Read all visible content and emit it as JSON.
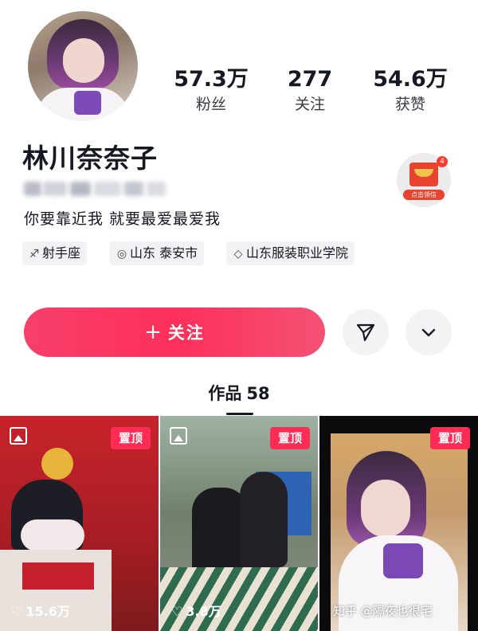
{
  "profile": {
    "username": "林川奈奈子",
    "signature": "你要靠近我 就要最爱最爱我"
  },
  "stats": [
    {
      "value": "57.3万",
      "label": "粉丝"
    },
    {
      "value": "277",
      "label": "关注"
    },
    {
      "value": "54.6万",
      "label": "获赞"
    }
  ],
  "tags": [
    {
      "icon": "zodiac-icon",
      "glyph": "♐",
      "label": "射手座"
    },
    {
      "icon": "location-icon",
      "glyph": "◎",
      "label": "山东 泰安市"
    },
    {
      "icon": "school-icon",
      "glyph": "◇",
      "label": "山东服装职业学院"
    }
  ],
  "gift_badge": {
    "count": "4",
    "label": "点击领信"
  },
  "actions": {
    "follow_label": "关注",
    "follow_glyph": "+",
    "share_icon": "send-icon",
    "more_icon": "chevron-down-icon"
  },
  "tab": {
    "label": "作品",
    "count": "58"
  },
  "posts": [
    {
      "pinned_label": "置顶",
      "likes": "15.6万",
      "type_icon": "image-icon"
    },
    {
      "pinned_label": "置顶",
      "likes": "3.8万",
      "type_icon": "image-icon"
    },
    {
      "pinned_label": "置顶",
      "likes": ""
    }
  ],
  "watermark": "知乎 @隔夜也很宅",
  "colors": {
    "accent": "#fe2c55",
    "text": "#161823",
    "chip_bg": "#f2f2f4"
  }
}
